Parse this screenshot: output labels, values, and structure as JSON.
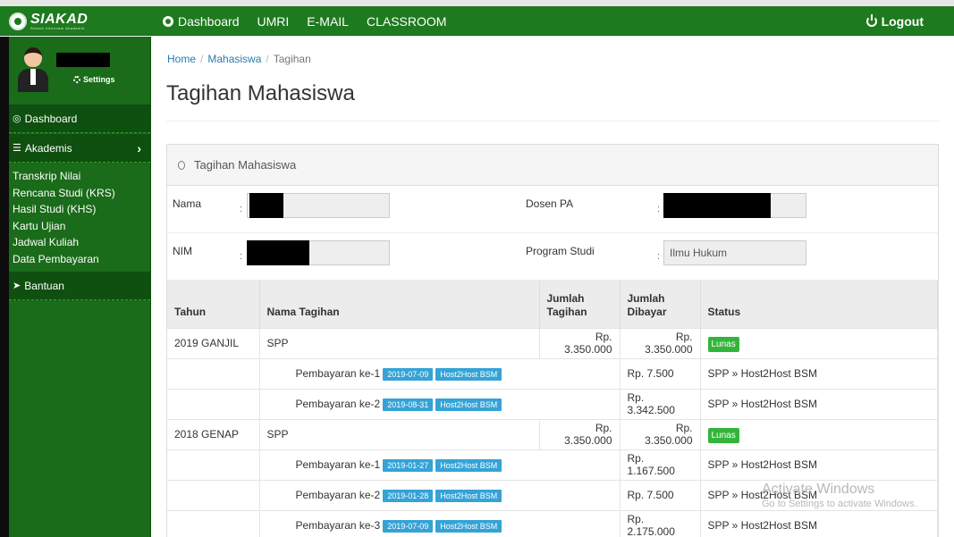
{
  "topbar": {
    "logo_text": "SIAKAD",
    "logo_subtitle": "Sistem Informasi Akademik",
    "nav": [
      "Dashboard",
      "UMRI",
      "E-MAIL",
      "CLASSROOM"
    ],
    "logout": "Logout"
  },
  "sidebar": {
    "settings": "Settings",
    "dashboard": "Dashboard",
    "akademis": "Akademis",
    "submenu": [
      "Transkrip Nilai",
      "Rencana Studi (KRS)",
      "Hasil Studi (KHS)",
      "Kartu Ujian",
      "Jadwal Kuliah",
      "Data Pembayaran"
    ],
    "bantuan": "Bantuan"
  },
  "breadcrumb": {
    "home": "Home",
    "mahasiswa": "Mahasiswa",
    "current": "Tagihan"
  },
  "page_title": "Tagihan Mahasiswa",
  "panel_title": "Tagihan Mahasiswa",
  "info": {
    "nama_label": "Nama",
    "nim_label": "NIM",
    "dosen_label": "Dosen PA",
    "prodi_label": "Program Studi",
    "prodi_value": "Ilmu Hukum",
    "colon": ":"
  },
  "table": {
    "headers": [
      "Tahun",
      "Nama Tagihan",
      "Jumlah Tagihan",
      "Jumlah Dibayar",
      "Status"
    ],
    "rows": [
      {
        "tahun": "2019 GANJIL",
        "nama": "SPP",
        "tagihan": "Rp. 3.350.000",
        "dibayar": "Rp. 3.350.000",
        "status": "Lunas"
      },
      {
        "pay": "Pembayaran ke-1",
        "date": "2019-07-09",
        "bank": "Host2Host BSM",
        "dibayar": "Rp. 7.500",
        "status": "SPP » Host2Host BSM"
      },
      {
        "pay": "Pembayaran ke-2",
        "date": "2019-08-31",
        "bank": "Host2Host BSM",
        "dibayar": "Rp. 3.342.500",
        "status": "SPP » Host2Host BSM"
      },
      {
        "tahun": "2018 GENAP",
        "nama": "SPP",
        "tagihan": "Rp. 3.350.000",
        "dibayar": "Rp. 3.350.000",
        "status": "Lunas"
      },
      {
        "pay": "Pembayaran ke-1",
        "date": "2019-01-27",
        "bank": "Host2Host BSM",
        "dibayar": "Rp. 1.167.500",
        "status": "SPP » Host2Host BSM"
      },
      {
        "pay": "Pembayaran ke-2",
        "date": "2019-01-28",
        "bank": "Host2Host BSM",
        "dibayar": "Rp. 7.500",
        "status": "SPP » Host2Host BSM"
      },
      {
        "pay": "Pembayaran ke-3",
        "date": "2019-07-09",
        "bank": "Host2Host BSM",
        "dibayar": "Rp. 2.175.000",
        "status": "SPP » Host2Host BSM"
      }
    ]
  },
  "watermark": {
    "line1": "Activate Windows",
    "line2": "Go to Settings to activate Windows."
  }
}
